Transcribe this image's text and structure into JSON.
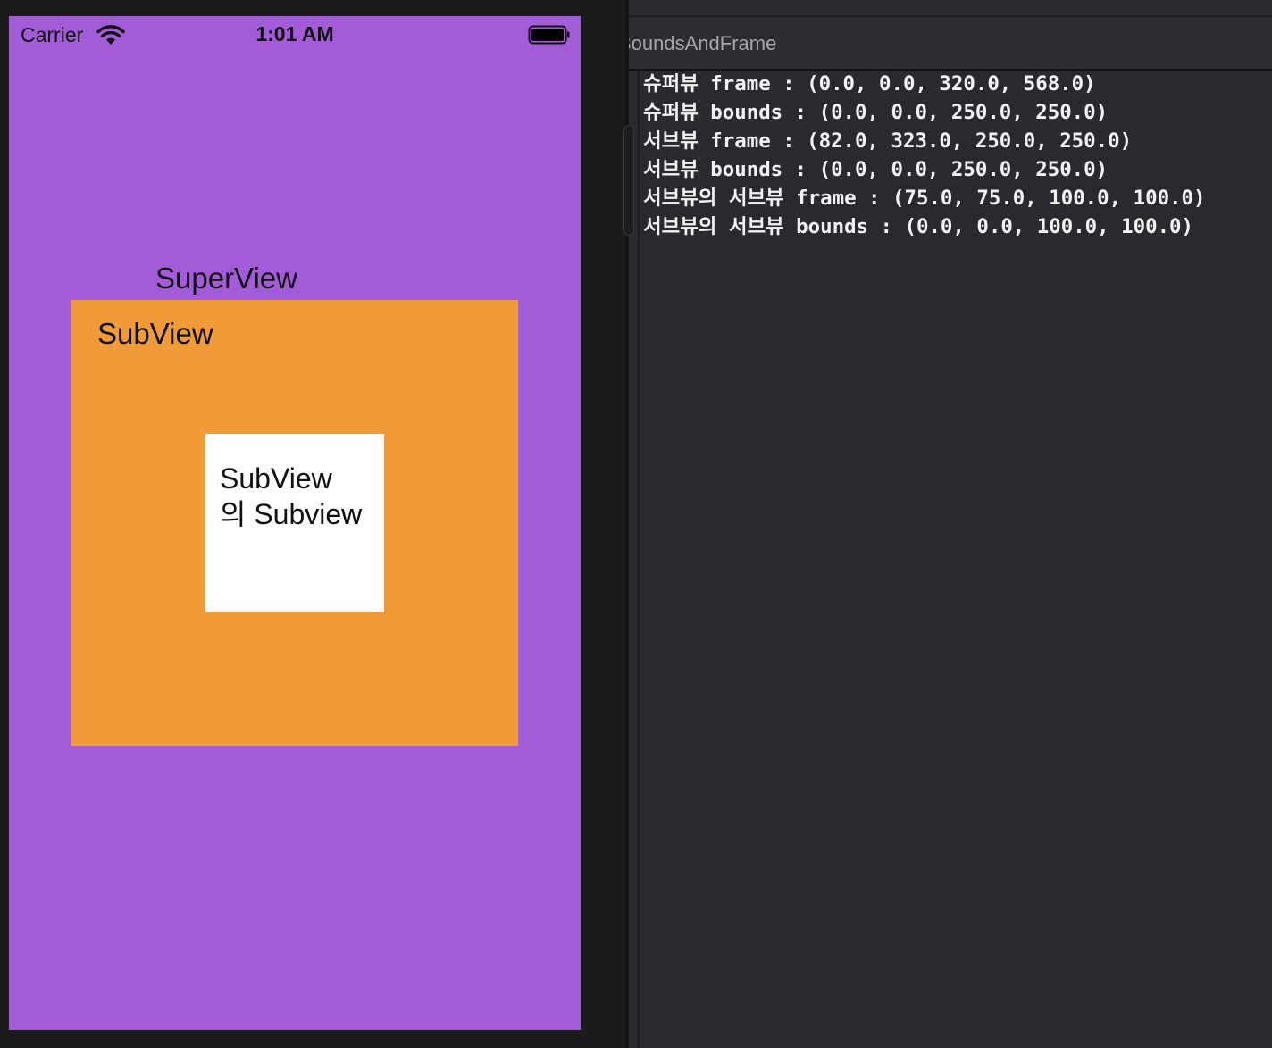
{
  "status_bar": {
    "carrier": "Carrier",
    "time": "1:01 AM"
  },
  "app": {
    "superview_label": "SuperView",
    "subview_label": "SubView",
    "subsubview_label_line1": "SubView",
    "subsubview_label_line2": "의 Subview"
  },
  "colors": {
    "superview_bg": "#a35cd8",
    "subview_bg": "#f09a38",
    "subsubview_bg": "#ffffff",
    "console_bg": "#292a2f"
  },
  "xcode": {
    "tab_title": "BoundsAndFrame",
    "console_lines": [
      "슈퍼뷰 frame : (0.0, 0.0, 320.0, 568.0)",
      "슈퍼뷰 bounds : (0.0, 0.0, 250.0, 250.0)",
      "서브뷰 frame : (82.0, 323.0, 250.0, 250.0)",
      "서브뷰 bounds : (0.0, 0.0, 250.0, 250.0)",
      "서브뷰의 서브뷰 frame : (75.0, 75.0, 100.0, 100.0)",
      "서브뷰의 서브뷰 bounds : (0.0, 0.0, 100.0, 100.0)"
    ]
  }
}
